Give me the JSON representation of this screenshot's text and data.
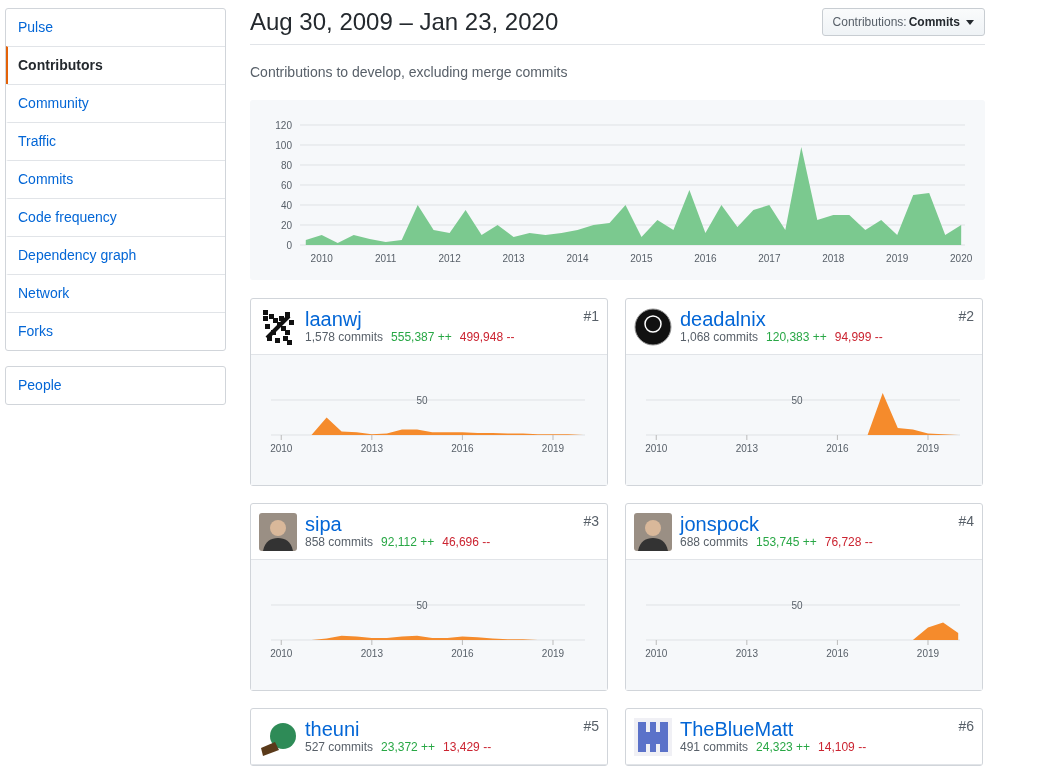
{
  "sidebar": {
    "groups": [
      {
        "items": [
          {
            "label": "Pulse",
            "selected": false
          },
          {
            "label": "Contributors",
            "selected": true
          },
          {
            "label": "Community",
            "selected": false
          },
          {
            "label": "Traffic",
            "selected": false
          },
          {
            "label": "Commits",
            "selected": false
          },
          {
            "label": "Code frequency",
            "selected": false
          },
          {
            "label": "Dependency graph",
            "selected": false
          },
          {
            "label": "Network",
            "selected": false
          },
          {
            "label": "Forks",
            "selected": false
          }
        ]
      },
      {
        "items": [
          {
            "label": "People",
            "selected": false
          }
        ]
      }
    ]
  },
  "header": {
    "title": "Aug 30, 2009 – Jan 23, 2020",
    "dropdown": {
      "label": "Contributions:",
      "value": "Commits"
    }
  },
  "subtitle": "Contributions to develop, excluding merge commits",
  "overview": {
    "chart_data": {
      "type": "area",
      "grid": true,
      "xlim": [
        2009.66,
        2020.06
      ],
      "ylim": [
        0,
        120
      ],
      "xticks": [
        2010,
        2011,
        2012,
        2013,
        2014,
        2015,
        2016,
        2017,
        2018,
        2019,
        2020
      ],
      "yticks": [
        0,
        20,
        40,
        60,
        80,
        100,
        120
      ],
      "x": [
        2009.75,
        2010,
        2010.25,
        2010.5,
        2010.75,
        2011,
        2011.25,
        2011.5,
        2011.75,
        2012,
        2012.25,
        2012.5,
        2012.75,
        2013,
        2013.25,
        2013.5,
        2013.75,
        2014,
        2014.25,
        2014.5,
        2014.75,
        2015,
        2015.25,
        2015.5,
        2015.75,
        2016,
        2016.25,
        2016.5,
        2016.75,
        2017,
        2017.25,
        2017.5,
        2017.75,
        2018,
        2018.25,
        2018.5,
        2018.75,
        2019,
        2019.25,
        2019.5,
        2019.75,
        2020
      ],
      "series": [
        {
          "color": "#7bc98f",
          "values": [
            5,
            10,
            2,
            10,
            6,
            3,
            5,
            40,
            15,
            12,
            35,
            10,
            20,
            8,
            12,
            10,
            12,
            15,
            20,
            22,
            40,
            8,
            25,
            15,
            55,
            12,
            40,
            18,
            35,
            40,
            15,
            98,
            25,
            30,
            30,
            15,
            25,
            10,
            50,
            52,
            10,
            20
          ]
        }
      ]
    }
  },
  "contributors": [
    {
      "rank": "#1",
      "name": "laanwj",
      "commits": "1,578 commits",
      "additions": "555,387 ++",
      "deletions": "499,948 --",
      "activity": {
        "gridline_label": "50",
        "year_labels": [
          "2010",
          "2013",
          "2016",
          "2019"
        ]
      }
    },
    {
      "rank": "#2",
      "name": "deadalnix",
      "commits": "1,068 commits",
      "additions": "120,383 ++",
      "deletions": "94,999 --",
      "activity": {
        "gridline_label": "50",
        "year_labels": [
          "2010",
          "2013",
          "2016",
          "2019"
        ]
      }
    },
    {
      "rank": "#3",
      "name": "sipa",
      "commits": "858 commits",
      "additions": "92,112 ++",
      "deletions": "46,696 --",
      "activity": {
        "gridline_label": "50",
        "year_labels": [
          "2010",
          "2013",
          "2016",
          "2019"
        ]
      }
    },
    {
      "rank": "#4",
      "name": "jonspock",
      "commits": "688 commits",
      "additions": "153,745 ++",
      "deletions": "76,728 --",
      "activity": {
        "gridline_label": "50",
        "year_labels": [
          "2010",
          "2013",
          "2016",
          "2019"
        ]
      }
    },
    {
      "rank": "#5",
      "name": "theuni",
      "commits": "527 commits",
      "additions": "23,372 ++",
      "deletions": "13,429 --"
    },
    {
      "rank": "#6",
      "name": "TheBlueMatt",
      "commits": "491 commits",
      "additions": "24,323 ++",
      "deletions": "14,109 --"
    }
  ]
}
